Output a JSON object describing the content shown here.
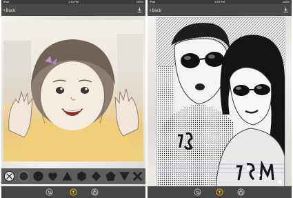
{
  "status_bar": {
    "carrier": "iPad",
    "time": "1:10 PM",
    "battery": "100%"
  },
  "nav": {
    "back_label": "Back"
  },
  "icons": {
    "download": "download-icon",
    "undo": "undo-icon",
    "filter": "filter-icon",
    "share": "share-icon"
  },
  "shapes": [
    "none",
    "circle-outline",
    "circle",
    "heart",
    "triangle",
    "hexagon",
    "diamond",
    "pentagon",
    "inverted-triangle",
    "x-shape"
  ],
  "colors": {
    "nav_bar": "#4a4a4a",
    "shape_bar": "#5e5e5e",
    "accent_yellow": "#f2c200"
  }
}
